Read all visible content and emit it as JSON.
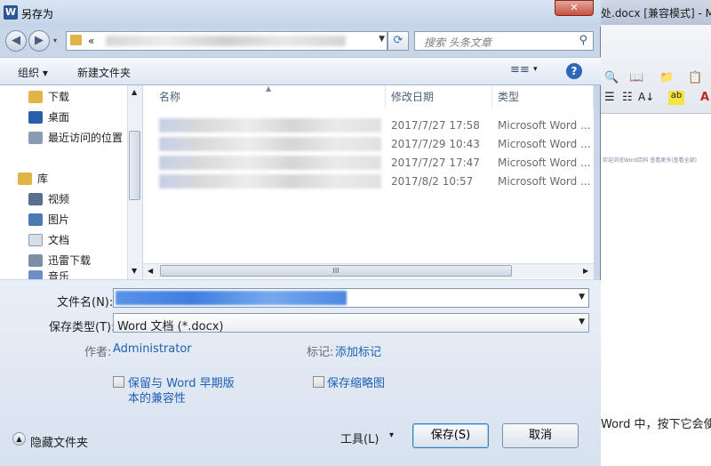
{
  "background_window": {
    "title": "处.docx [兼容模式] - M",
    "doc_line": "Word 中，按下它会使",
    "tiny_text": "欢迎浏览Word百科  查看更多(查看全部)"
  },
  "dialog": {
    "title": "另存为",
    "app_icon": "W",
    "close_icon": "✕"
  },
  "address": {
    "path_prefix": "«",
    "search_placeholder": "搜索 头条文章"
  },
  "toolbar": {
    "organize_label": "组织 ▾",
    "new_folder_label": "新建文件夹",
    "view_icon": "≡≡",
    "view_dropdown": "▾",
    "help": "?"
  },
  "nav": {
    "items": [
      {
        "label": "下载",
        "icon": "download-folder-icon",
        "color": "#e1b447"
      },
      {
        "label": "桌面",
        "icon": "desktop-icon",
        "color": "#2a5ea8"
      },
      {
        "label": "最近访问的位置",
        "icon": "recent-places-icon",
        "color": "#8a9bb3"
      },
      {
        "label": "库",
        "icon": "library-icon",
        "color": "#e1b447"
      },
      {
        "label": "视频",
        "icon": "video-icon",
        "color": "#5a6f8e"
      },
      {
        "label": "图片",
        "icon": "picture-icon",
        "color": "#4f7ab0"
      },
      {
        "label": "文档",
        "icon": "document-icon",
        "color": "#d8dee8"
      },
      {
        "label": "迅雷下载",
        "icon": "xunlei-download-icon",
        "color": "#7d8fa8"
      },
      {
        "label": "音乐",
        "icon": "music-icon",
        "color": "#6d8fc7"
      }
    ]
  },
  "file_list": {
    "columns": [
      "名称",
      "修改日期",
      "类型"
    ],
    "rows": [
      {
        "date": "2017/7/27 17:58",
        "type": "Microsoft Word ..."
      },
      {
        "date": "2017/7/29 10:43",
        "type": "Microsoft Word ..."
      },
      {
        "date": "2017/7/27 17:47",
        "type": "Microsoft Word ..."
      },
      {
        "date": "2017/8/2 10:57",
        "type": "Microsoft Word ..."
      }
    ],
    "hscroll_grip": "III"
  },
  "form": {
    "filename_label": "文件名(N):",
    "filetype_label": "保存类型(T):",
    "filetype_value": "Word 文档 (*.docx)",
    "author_label": "作者:",
    "author_value": "Administrator",
    "tags_label": "标记:",
    "tags_value": "添加标记",
    "compat_line1": "保留与 Word 早期版",
    "compat_line2": "本的兼容性",
    "thumbnail_label": "保存缩略图"
  },
  "buttons": {
    "hide_folders": "隐藏文件夹",
    "tools": "工具(L)",
    "tools_drop": "▾",
    "save": "保存(S)",
    "cancel": "取消"
  }
}
